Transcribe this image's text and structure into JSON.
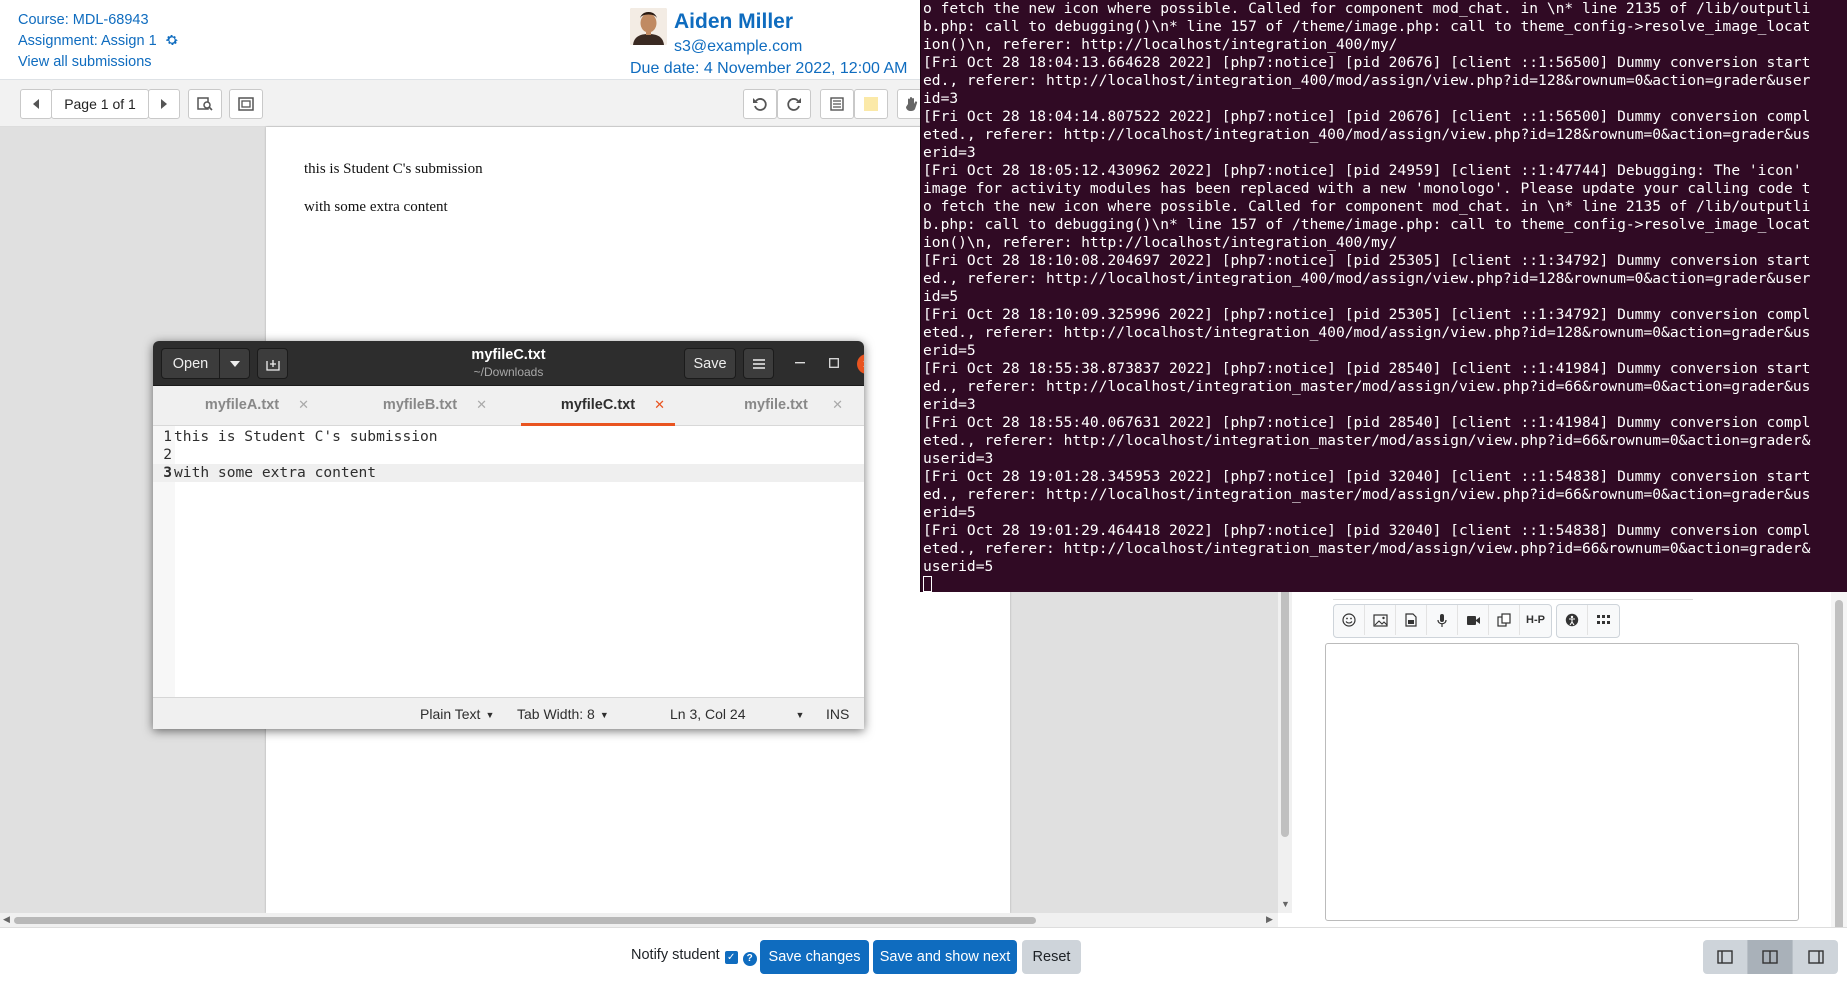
{
  "grader": {
    "course_link": "Course: MDL-68943",
    "assignment_link": "Assignment: Assign 1",
    "view_all_link": "View all submissions",
    "user_name": "Aiden Miller",
    "user_email": "s3@example.com",
    "due_date": "Due date: 4 November 2022, 12:00 AM"
  },
  "pdf_toolbar": {
    "page_label": "Page 1 of 1"
  },
  "document": {
    "lines": [
      "this is Student C's submission",
      "with some extra content"
    ]
  },
  "footer": {
    "notify_label": "Notify student",
    "save_changes": "Save changes",
    "save_and_show_next": "Save and show next",
    "reset": "Reset"
  },
  "editor_toolbar": {
    "h5p_label": "H-P"
  },
  "terminal": {
    "lines": [
      "o fetch the new icon where possible. Called for component mod_chat. in \\n* line 2135 of /lib/outputli",
      "b.php: call to debugging()\\n* line 157 of /theme/image.php: call to theme_config->resolve_image_locat",
      "ion()\\n, referer: http://localhost/integration_400/my/",
      "[Fri Oct 28 18:04:13.664628 2022] [php7:notice] [pid 20676] [client ::1:56500] Dummy conversion start",
      "ed., referer: http://localhost/integration_400/mod/assign/view.php?id=128&rownum=0&action=grader&user",
      "id=3",
      "[Fri Oct 28 18:04:14.807522 2022] [php7:notice] [pid 20676] [client ::1:56500] Dummy conversion compl",
      "eted., referer: http://localhost/integration_400/mod/assign/view.php?id=128&rownum=0&action=grader&us",
      "erid=3",
      "[Fri Oct 28 18:05:12.430962 2022] [php7:notice] [pid 24959] [client ::1:47744] Debugging: The 'icon'",
      "image for activity modules has been replaced with a new 'monologo'. Please update your calling code t",
      "o fetch the new icon where possible. Called for component mod_chat. in \\n* line 2135 of /lib/outputli",
      "b.php: call to debugging()\\n* line 157 of /theme/image.php: call to theme_config->resolve_image_locat",
      "ion()\\n, referer: http://localhost/integration_400/my/",
      "[Fri Oct 28 18:10:08.204697 2022] [php7:notice] [pid 25305] [client ::1:34792] Dummy conversion start",
      "ed., referer: http://localhost/integration_400/mod/assign/view.php?id=128&rownum=0&action=grader&user",
      "id=5",
      "[Fri Oct 28 18:10:09.325996 2022] [php7:notice] [pid 25305] [client ::1:34792] Dummy conversion compl",
      "eted., referer: http://localhost/integration_400/mod/assign/view.php?id=128&rownum=0&action=grader&us",
      "erid=5",
      "[Fri Oct 28 18:55:38.873837 2022] [php7:notice] [pid 28540] [client ::1:41984] Dummy conversion start",
      "ed., referer: http://localhost/integration_master/mod/assign/view.php?id=66&rownum=0&action=grader&us",
      "erid=3",
      "[Fri Oct 28 18:55:40.067631 2022] [php7:notice] [pid 28540] [client ::1:41984] Dummy conversion compl",
      "eted., referer: http://localhost/integration_master/mod/assign/view.php?id=66&rownum=0&action=grader&",
      "userid=3",
      "[Fri Oct 28 19:01:28.345953 2022] [php7:notice] [pid 32040] [client ::1:54838] Dummy conversion start",
      "ed., referer: http://localhost/integration_master/mod/assign/view.php?id=66&rownum=0&action=grader&us",
      "erid=5",
      "[Fri Oct 28 19:01:29.464418 2022] [php7:notice] [pid 32040] [client ::1:54838] Dummy conversion compl",
      "eted., referer: http://localhost/integration_master/mod/assign/view.php?id=66&rownum=0&action=grader&",
      "userid=5"
    ]
  },
  "gedit": {
    "open_label": "Open",
    "title": "myfileC.txt",
    "subtitle": "~/Downloads",
    "save_label": "Save",
    "tabs": [
      {
        "label": "myfileA.txt",
        "active": false
      },
      {
        "label": "myfileB.txt",
        "active": false
      },
      {
        "label": "myfileC.txt",
        "active": true
      },
      {
        "label": "myfile.txt",
        "active": false
      }
    ],
    "lines": [
      {
        "num": "1",
        "text": "this is Student C's submission"
      },
      {
        "num": "2",
        "text": ""
      },
      {
        "num": "3",
        "text": "with some extra content"
      }
    ],
    "current_line": 3,
    "status": {
      "language": "Plain Text",
      "tab_width": "Tab Width: 8",
      "position": "Ln 3, Col 24",
      "mode": "INS"
    }
  },
  "colors": {
    "link": "#0f6cbf",
    "primary_button": "#0f6cbf",
    "terminal_bg": "#300a24",
    "gedit_accent": "#e95420",
    "gedit_header": "#2d2d2d"
  }
}
